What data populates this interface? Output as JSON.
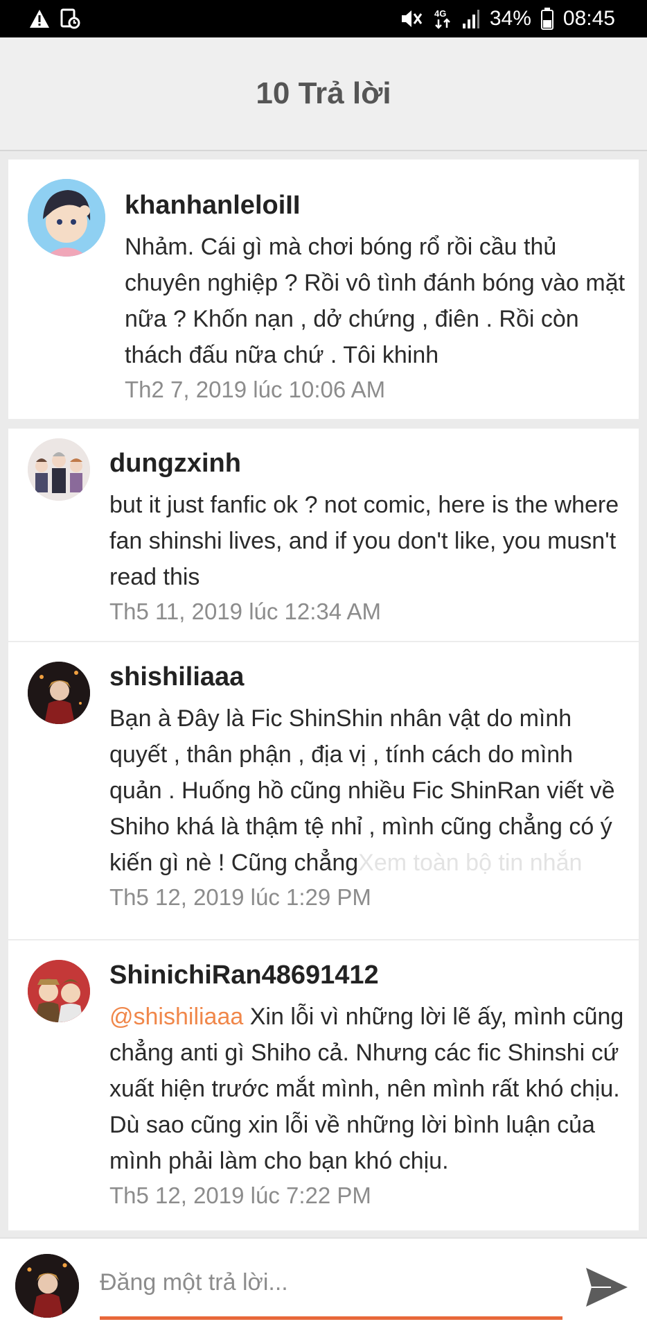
{
  "status_bar": {
    "battery": "34%",
    "time": "08:45",
    "network": "4G"
  },
  "header": {
    "title": "10 Trả lời"
  },
  "comments": [
    {
      "username": "khanhanleloiII",
      "text": "Nhảm. Cái gì mà chơi bóng rổ rồi cầu thủ chuyên nghiệp ? Rồi vô tình đánh bóng vào mặt nữa ? Khốn nạn , dở chứng , điên . Rồi còn thách đấu nữa chứ . Tôi khinh",
      "time": "Th2 7, 2019 lúc 10:06 AM"
    },
    {
      "username": "dungzxinh",
      "text": "but it just fanfic ok ? not comic, here is the where fan shinshi lives, and if you don't like, you musn't read this",
      "time": "Th5 11, 2019 lúc 12:34 AM"
    },
    {
      "username": "shishiliaaa",
      "text": "Bạn à Đây là Fic ShinShin nhân vật do mình quyết , thân phận , địa vị , tính cách do mình quản . Huống hồ cũng nhiều Fic ShinRan viết về Shiho khá là thậm tệ nhỉ , mình cũng chẳng có ý kiến gì nè ! Cũng chẳng",
      "see_more": "Xem toàn bộ tin nhắn",
      "time": "Th5 12, 2019 lúc 1:29 PM"
    },
    {
      "username": "ShinichiRan48691412",
      "mention": "@shishiliaaa",
      "text": " Xin lỗi vì những lời lẽ ấy, mình cũng chẳng anti gì Shiho cả. Nhưng các fic Shinshi cứ xuất hiện trước mắt mình, nên mình rất khó chịu. Dù sao cũng xin lỗi về những lời bình luận của mình phải làm cho bạn khó chịu.",
      "time": "Th5 12, 2019 lúc 7:22 PM"
    }
  ],
  "composer": {
    "placeholder": "Đăng một trả lời..."
  },
  "colors": {
    "accent": "#e8683a",
    "mention": "#f0874a"
  }
}
